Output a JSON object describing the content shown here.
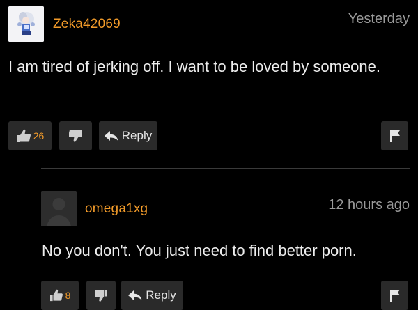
{
  "colors": {
    "accent": "#f29b2a",
    "button_bg": "#2a2a2a",
    "bg": "#000000",
    "muted": "#9a9a9a"
  },
  "comments": [
    {
      "username": "Zeka42069",
      "time": "Yesterday",
      "text": "I am tired of jerking off. I want to be loved by someone.",
      "upvotes": "26",
      "reply_label": "Reply"
    },
    {
      "username": "omega1xg",
      "time": "12 hours ago",
      "text": "No you don't. You just need to find better porn.",
      "upvotes": "8",
      "reply_label": "Reply"
    }
  ],
  "icons": {
    "thumbs_up": "thumbs-up-icon",
    "thumbs_down": "thumbs-down-icon",
    "reply": "reply-arrow-icon",
    "flag": "flag-icon"
  }
}
